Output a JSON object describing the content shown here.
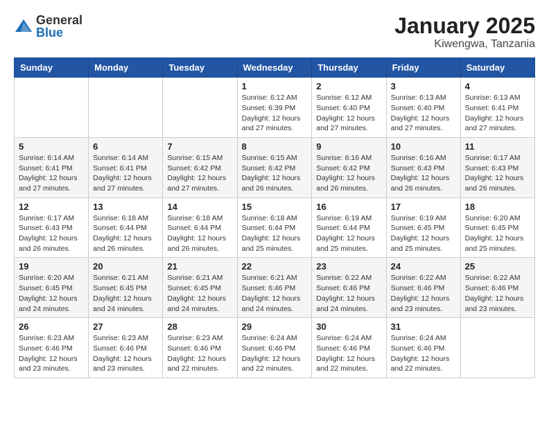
{
  "logo": {
    "text_general": "General",
    "text_blue": "Blue"
  },
  "title": "January 2025",
  "location": "Kiwengwa, Tanzania",
  "weekdays": [
    "Sunday",
    "Monday",
    "Tuesday",
    "Wednesday",
    "Thursday",
    "Friday",
    "Saturday"
  ],
  "weeks": [
    [
      {
        "day": "",
        "info": ""
      },
      {
        "day": "",
        "info": ""
      },
      {
        "day": "",
        "info": ""
      },
      {
        "day": "1",
        "info": "Sunrise: 6:12 AM\nSunset: 6:39 PM\nDaylight: 12 hours and 27 minutes."
      },
      {
        "day": "2",
        "info": "Sunrise: 6:12 AM\nSunset: 6:40 PM\nDaylight: 12 hours and 27 minutes."
      },
      {
        "day": "3",
        "info": "Sunrise: 6:13 AM\nSunset: 6:40 PM\nDaylight: 12 hours and 27 minutes."
      },
      {
        "day": "4",
        "info": "Sunrise: 6:13 AM\nSunset: 6:41 PM\nDaylight: 12 hours and 27 minutes."
      }
    ],
    [
      {
        "day": "5",
        "info": "Sunrise: 6:14 AM\nSunset: 6:41 PM\nDaylight: 12 hours and 27 minutes."
      },
      {
        "day": "6",
        "info": "Sunrise: 6:14 AM\nSunset: 6:41 PM\nDaylight: 12 hours and 27 minutes."
      },
      {
        "day": "7",
        "info": "Sunrise: 6:15 AM\nSunset: 6:42 PM\nDaylight: 12 hours and 27 minutes."
      },
      {
        "day": "8",
        "info": "Sunrise: 6:15 AM\nSunset: 6:42 PM\nDaylight: 12 hours and 26 minutes."
      },
      {
        "day": "9",
        "info": "Sunrise: 6:16 AM\nSunset: 6:42 PM\nDaylight: 12 hours and 26 minutes."
      },
      {
        "day": "10",
        "info": "Sunrise: 6:16 AM\nSunset: 6:43 PM\nDaylight: 12 hours and 26 minutes."
      },
      {
        "day": "11",
        "info": "Sunrise: 6:17 AM\nSunset: 6:43 PM\nDaylight: 12 hours and 26 minutes."
      }
    ],
    [
      {
        "day": "12",
        "info": "Sunrise: 6:17 AM\nSunset: 6:43 PM\nDaylight: 12 hours and 26 minutes."
      },
      {
        "day": "13",
        "info": "Sunrise: 6:18 AM\nSunset: 6:44 PM\nDaylight: 12 hours and 26 minutes."
      },
      {
        "day": "14",
        "info": "Sunrise: 6:18 AM\nSunset: 6:44 PM\nDaylight: 12 hours and 26 minutes."
      },
      {
        "day": "15",
        "info": "Sunrise: 6:18 AM\nSunset: 6:44 PM\nDaylight: 12 hours and 25 minutes."
      },
      {
        "day": "16",
        "info": "Sunrise: 6:19 AM\nSunset: 6:44 PM\nDaylight: 12 hours and 25 minutes."
      },
      {
        "day": "17",
        "info": "Sunrise: 6:19 AM\nSunset: 6:45 PM\nDaylight: 12 hours and 25 minutes."
      },
      {
        "day": "18",
        "info": "Sunrise: 6:20 AM\nSunset: 6:45 PM\nDaylight: 12 hours and 25 minutes."
      }
    ],
    [
      {
        "day": "19",
        "info": "Sunrise: 6:20 AM\nSunset: 6:45 PM\nDaylight: 12 hours and 24 minutes."
      },
      {
        "day": "20",
        "info": "Sunrise: 6:21 AM\nSunset: 6:45 PM\nDaylight: 12 hours and 24 minutes."
      },
      {
        "day": "21",
        "info": "Sunrise: 6:21 AM\nSunset: 6:45 PM\nDaylight: 12 hours and 24 minutes."
      },
      {
        "day": "22",
        "info": "Sunrise: 6:21 AM\nSunset: 6:46 PM\nDaylight: 12 hours and 24 minutes."
      },
      {
        "day": "23",
        "info": "Sunrise: 6:22 AM\nSunset: 6:46 PM\nDaylight: 12 hours and 24 minutes."
      },
      {
        "day": "24",
        "info": "Sunrise: 6:22 AM\nSunset: 6:46 PM\nDaylight: 12 hours and 23 minutes."
      },
      {
        "day": "25",
        "info": "Sunrise: 6:22 AM\nSunset: 6:46 PM\nDaylight: 12 hours and 23 minutes."
      }
    ],
    [
      {
        "day": "26",
        "info": "Sunrise: 6:23 AM\nSunset: 6:46 PM\nDaylight: 12 hours and 23 minutes."
      },
      {
        "day": "27",
        "info": "Sunrise: 6:23 AM\nSunset: 6:46 PM\nDaylight: 12 hours and 23 minutes."
      },
      {
        "day": "28",
        "info": "Sunrise: 6:23 AM\nSunset: 6:46 PM\nDaylight: 12 hours and 22 minutes."
      },
      {
        "day": "29",
        "info": "Sunrise: 6:24 AM\nSunset: 6:46 PM\nDaylight: 12 hours and 22 minutes."
      },
      {
        "day": "30",
        "info": "Sunrise: 6:24 AM\nSunset: 6:46 PM\nDaylight: 12 hours and 22 minutes."
      },
      {
        "day": "31",
        "info": "Sunrise: 6:24 AM\nSunset: 6:46 PM\nDaylight: 12 hours and 22 minutes."
      },
      {
        "day": "",
        "info": ""
      }
    ]
  ]
}
